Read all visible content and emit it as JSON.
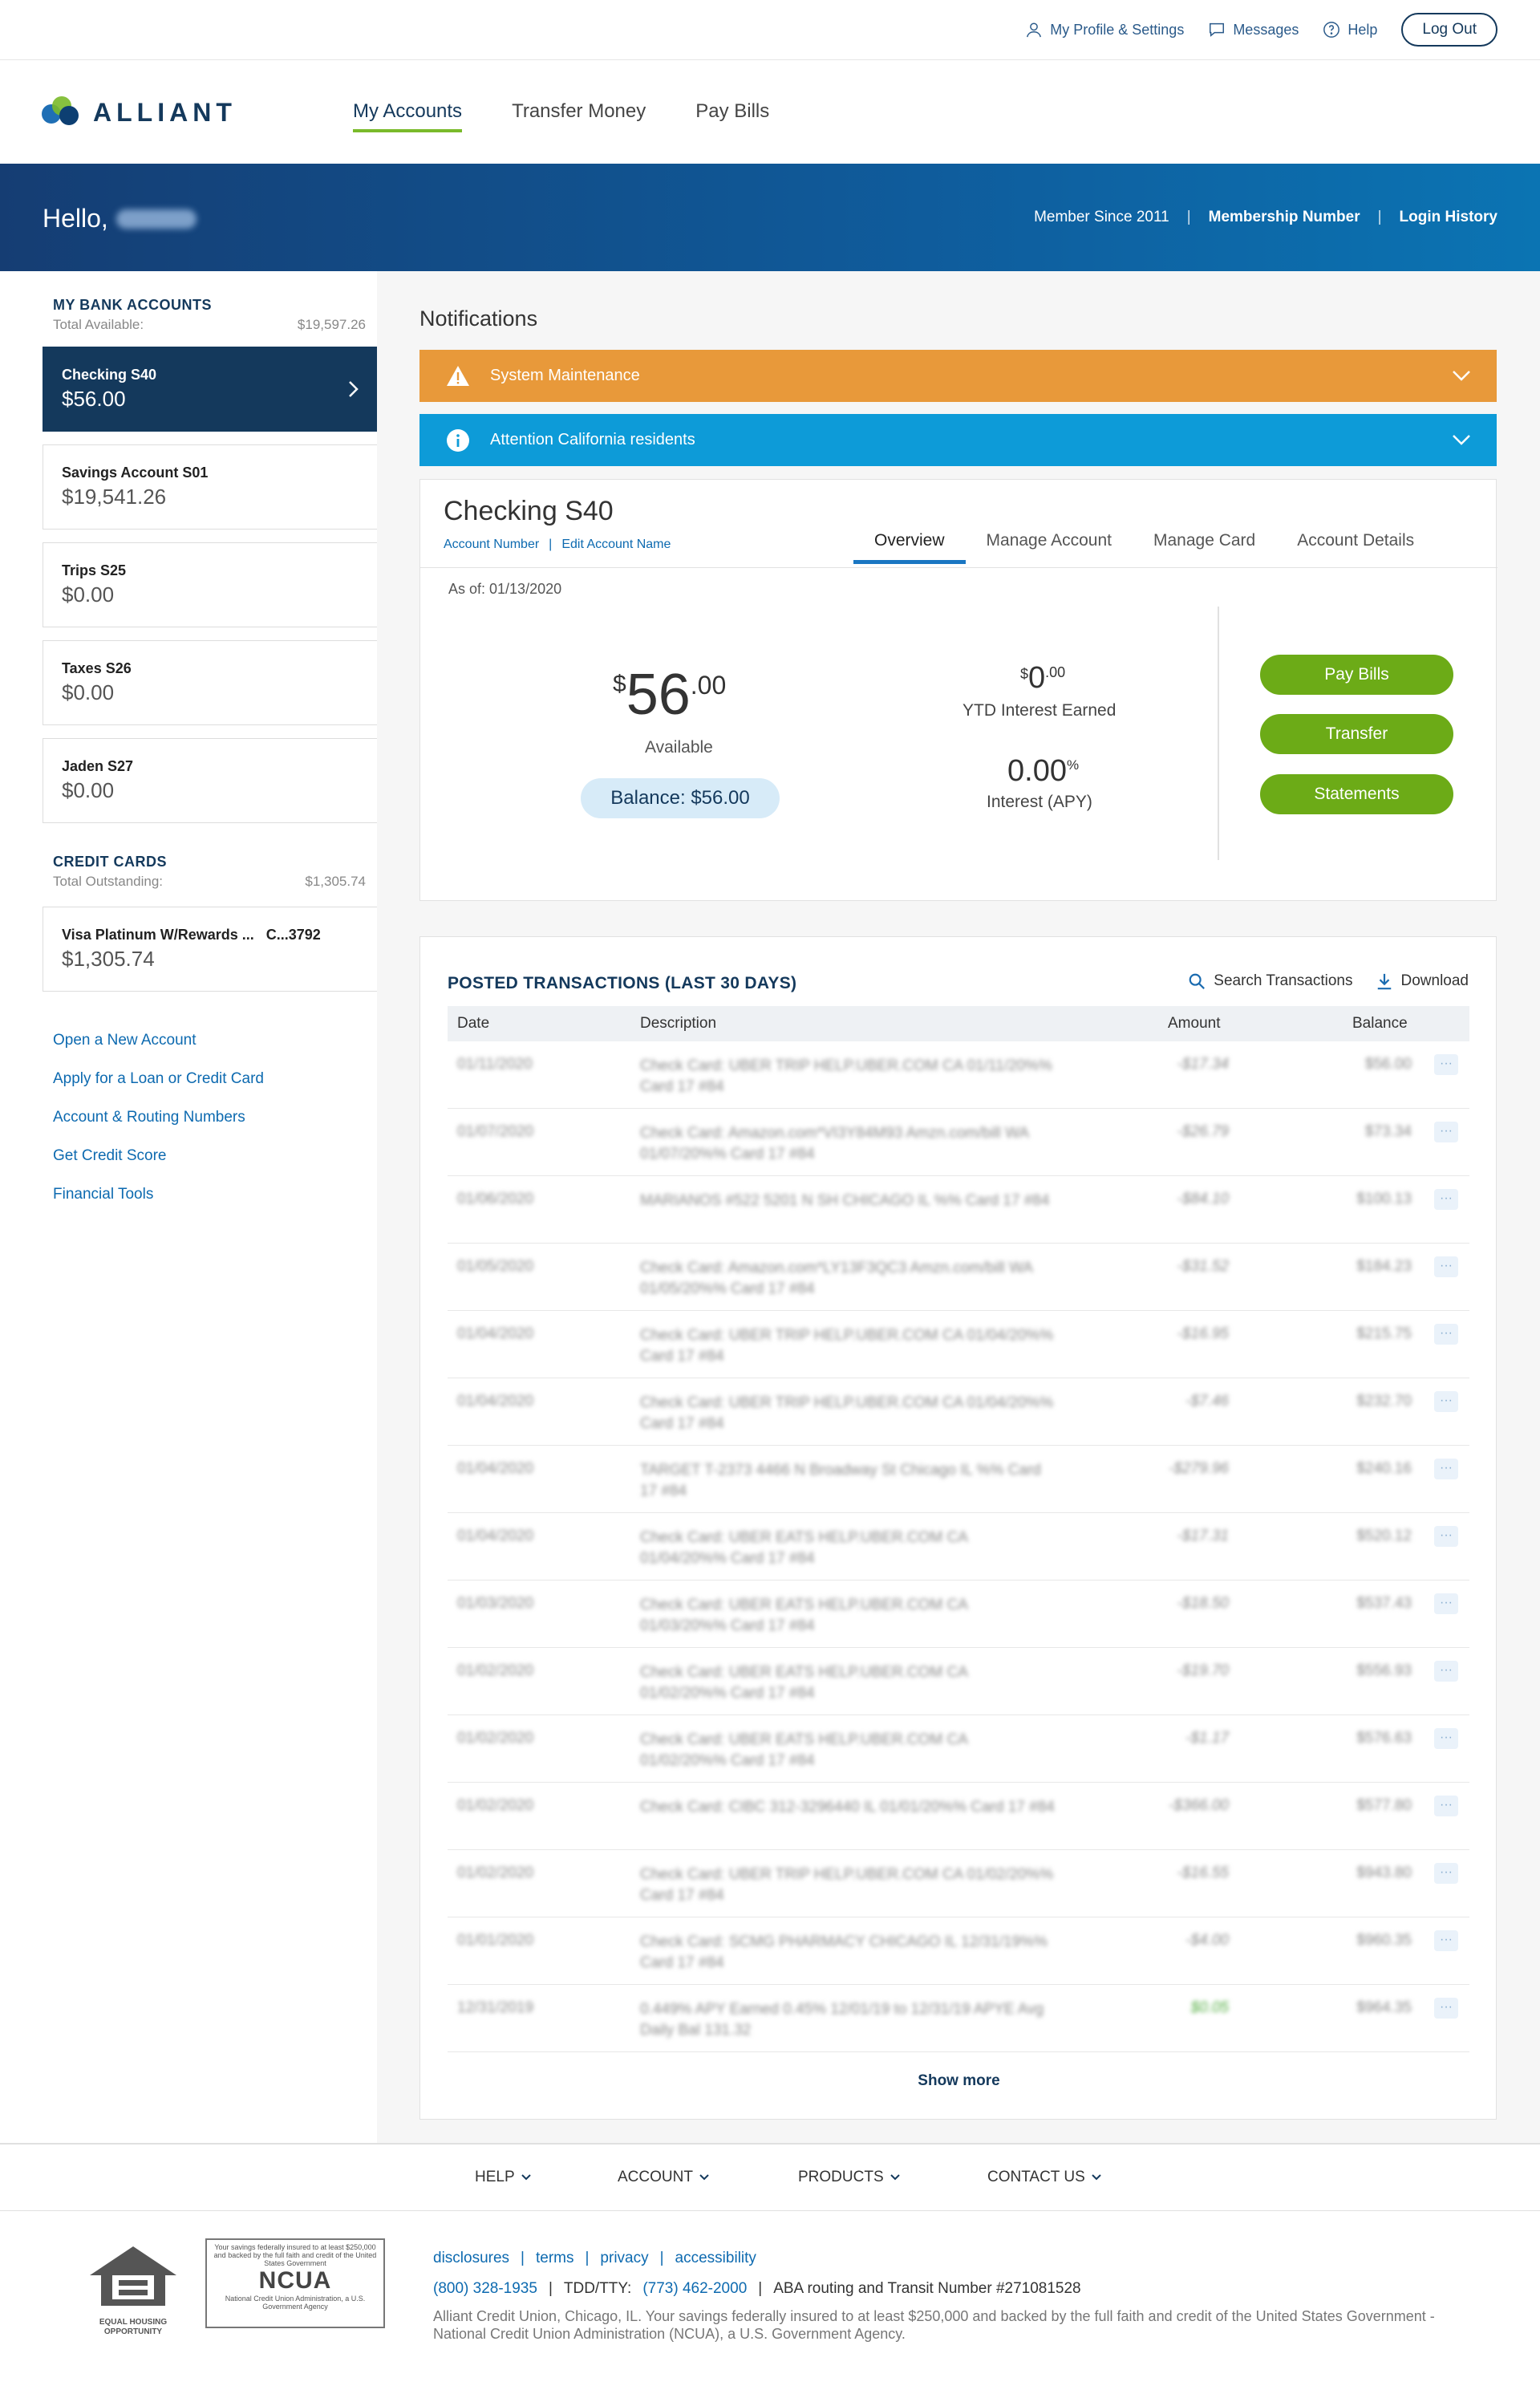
{
  "util": {
    "profile": "My Profile & Settings",
    "messages": "Messages",
    "help": "Help",
    "logout": "Log Out"
  },
  "brand": {
    "name": "ALLIANT",
    "colors": {
      "navy": "#14395c",
      "green": "#6cab17",
      "blue": "#1a76c2"
    }
  },
  "nav": {
    "items": [
      "My Accounts",
      "Transfer Money",
      "Pay Bills"
    ],
    "active": "My Accounts"
  },
  "hero": {
    "greeting": "Hello,",
    "member_since": "Member Since 2011",
    "membership_number": "Membership Number",
    "login_history": "Login History"
  },
  "sidebar": {
    "bank_title": "MY BANK ACCOUNTS",
    "bank_total_label": "Total Available:",
    "bank_total_value": "$19,597.26",
    "accounts": [
      {
        "name": "Checking S40",
        "balance": "$56.00",
        "active": true
      },
      {
        "name": "Savings Account S01",
        "balance": "$19,541.26"
      },
      {
        "name": "Trips S25",
        "balance": "$0.00"
      },
      {
        "name": "Taxes S26",
        "balance": "$0.00"
      },
      {
        "name": "Jaden S27",
        "balance": "$0.00"
      }
    ],
    "credit_title": "CREDIT CARDS",
    "credit_total_label": "Total Outstanding:",
    "credit_total_value": "$1,305.74",
    "credit_card": {
      "name": "Visa Platinum W/Rewards ...   C...3792",
      "balance": "$1,305.74"
    },
    "links": [
      "Open a New Account",
      "Apply for a Loan or Credit Card",
      "Account & Routing Numbers",
      "Get Credit Score",
      "Financial Tools"
    ]
  },
  "notifications": {
    "title": "Notifications",
    "items": [
      {
        "text": "System Maintenance",
        "color": "#e8993a",
        "icon": "warning-icon"
      },
      {
        "text": "Attention California residents",
        "color": "#0d9bd8",
        "icon": "info-icon"
      }
    ]
  },
  "account": {
    "title": "Checking S40",
    "account_number_link": "Account Number",
    "edit_name_link": "Edit Account Name",
    "tabs": [
      "Overview",
      "Manage Account",
      "Manage Card",
      "Account Details"
    ],
    "active_tab": "Overview",
    "as_of": "As of: 01/13/2020",
    "available": {
      "currency": "$",
      "whole": "56",
      "cents": ".00",
      "label": "Available"
    },
    "balance_pill": "Balance: $56.00",
    "ytd": {
      "currency": "$",
      "whole": "0",
      "cents": ".00",
      "label": "YTD Interest Earned"
    },
    "apy": {
      "whole": "0.00",
      "pct": "%",
      "label": "Interest (APY)"
    },
    "actions": [
      "Pay Bills",
      "Transfer",
      "Statements"
    ]
  },
  "transactions": {
    "title": "POSTED TRANSACTIONS (LAST 30 DAYS)",
    "search": "Search Transactions",
    "download": "Download",
    "columns": [
      "Date",
      "Description",
      "Amount",
      "Balance"
    ],
    "rows": [
      {
        "date": "01/11/2020",
        "desc": "Check Card: UBER TRIP HELP.UBER.COM CA 01/11/20%% Card 17 #84",
        "amount": "-$17.34",
        "balance": "$56.00"
      },
      {
        "date": "01/07/2020",
        "desc": "Check Card: Amazon.com*VI3Y84M93 Amzn.com/bill WA 01/07/20%% Card 17 #84",
        "amount": "-$26.79",
        "balance": "$73.34"
      },
      {
        "date": "01/06/2020",
        "desc": "MARIANOS #522 5201 N SH CHICAGO IL %% Card 17 #84",
        "amount": "-$84.10",
        "balance": "$100.13"
      },
      {
        "date": "01/05/2020",
        "desc": "Check Card: Amazon.com*LY13F3QC3 Amzn.com/bill WA 01/05/20%% Card 17 #84",
        "amount": "-$31.52",
        "balance": "$184.23"
      },
      {
        "date": "01/04/2020",
        "desc": "Check Card: UBER TRIP HELP.UBER.COM CA 01/04/20%% Card 17 #84",
        "amount": "-$16.95",
        "balance": "$215.75"
      },
      {
        "date": "01/04/2020",
        "desc": "Check Card: UBER TRIP HELP.UBER.COM CA 01/04/20%% Card 17 #84",
        "amount": "-$7.46",
        "balance": "$232.70"
      },
      {
        "date": "01/04/2020",
        "desc": "TARGET T-2373 4466 N Broadway St Chicago IL %% Card 17 #84",
        "amount": "-$279.96",
        "balance": "$240.16"
      },
      {
        "date": "01/04/2020",
        "desc": "Check Card: UBER EATS HELP.UBER.COM CA 01/04/20%% Card 17 #84",
        "amount": "-$17.31",
        "balance": "$520.12"
      },
      {
        "date": "01/03/2020",
        "desc": "Check Card: UBER EATS HELP.UBER.COM CA 01/03/20%% Card 17 #84",
        "amount": "-$18.50",
        "balance": "$537.43"
      },
      {
        "date": "01/02/2020",
        "desc": "Check Card: UBER EATS HELP.UBER.COM CA 01/02/20%% Card 17 #84",
        "amount": "-$19.70",
        "balance": "$556.93"
      },
      {
        "date": "01/02/2020",
        "desc": "Check Card: UBER EATS HELP.UBER.COM CA 01/02/20%% Card 17 #84",
        "amount": "-$1.17",
        "balance": "$576.63"
      },
      {
        "date": "01/02/2020",
        "desc": "Check Card: CIBC 312-3296440 IL 01/01/20%% Card 17 #84",
        "amount": "-$366.00",
        "balance": "$577.80"
      },
      {
        "date": "01/02/2020",
        "desc": "Check Card: UBER TRIP HELP.UBER.COM CA 01/02/20%% Card 17 #84",
        "amount": "-$16.55",
        "balance": "$943.80"
      },
      {
        "date": "01/01/2020",
        "desc": "Check Card: SCMG PHARMACY CHICAGO IL 12/31/19%% Card 17 #84",
        "amount": "-$4.00",
        "balance": "$960.35"
      },
      {
        "date": "12/31/2019",
        "desc": "0.449% APY Earned 0.45% 12/01/19 to 12/31/19 APYE Avg Daily Bal 131.32",
        "amount": "$0.05",
        "balance": "$964.35"
      }
    ],
    "show_more": "Show more"
  },
  "footer": {
    "nav": [
      "HELP",
      "ACCOUNT",
      "PRODUCTS",
      "CONTACT US"
    ],
    "eho_text": "EQUAL HOUSING OPPORTUNITY",
    "ncua_top": "Your savings federally insured to at least $250,000 and backed by the full faith and credit of the United States Government",
    "ncua_big": "NCUA",
    "ncua_bottom": "National Credit Union Administration, a U.S. Government Agency",
    "links": [
      "disclosures",
      "terms",
      "privacy",
      "accessibility"
    ],
    "phone": "(800) 328-1935",
    "tdd_label": "TDD/TTY:",
    "tdd_phone": "(773) 462-2000",
    "aba": "ABA routing and Transit Number #271081528",
    "note": "Alliant Credit Union, Chicago, IL. Your savings federally insured to at least $250,000 and backed by the full faith and credit of the United States Government - National Credit Union Administration (NCUA), a U.S. Government Agency."
  }
}
